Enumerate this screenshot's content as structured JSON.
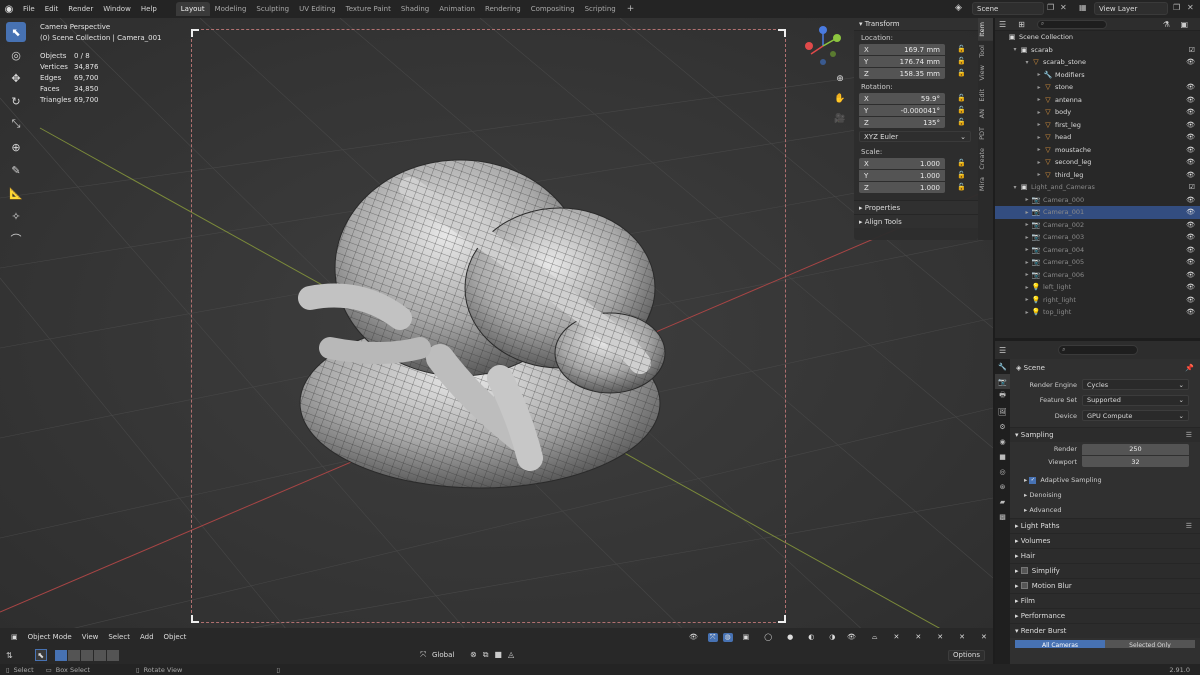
{
  "menu": [
    "File",
    "Edit",
    "Render",
    "Window",
    "Help"
  ],
  "workspaces": [
    "Layout",
    "Modeling",
    "Sculpting",
    "UV Editing",
    "Texture Paint",
    "Shading",
    "Animation",
    "Rendering",
    "Compositing",
    "Scripting"
  ],
  "active_workspace": "Layout",
  "scene_name": "Scene",
  "view_layer": "View Layer",
  "viewport": {
    "title": "Camera Perspective",
    "collection": "(0) Scene Collection | Camera_001",
    "stats": [
      {
        "k": "Objects",
        "v": "0 / 8"
      },
      {
        "k": "Vertices",
        "v": "34,876"
      },
      {
        "k": "Edges",
        "v": "69,700"
      },
      {
        "k": "Faces",
        "v": "34,850"
      },
      {
        "k": "Triangles",
        "v": "69,700"
      }
    ]
  },
  "npanel": {
    "header": "Transform",
    "location_label": "Location:",
    "location": [
      {
        "axis": "X",
        "value": "169.7 mm"
      },
      {
        "axis": "Y",
        "value": "176.74 mm"
      },
      {
        "axis": "Z",
        "value": "158.35 mm"
      }
    ],
    "rotation_label": "Rotation:",
    "rotation": [
      {
        "axis": "X",
        "value": "59.9°"
      },
      {
        "axis": "Y",
        "value": "-0.000041°"
      },
      {
        "axis": "Z",
        "value": "135°"
      }
    ],
    "rotation_mode": "XYZ Euler",
    "scale_label": "Scale:",
    "scale": [
      {
        "axis": "X",
        "value": "1.000"
      },
      {
        "axis": "Y",
        "value": "1.000"
      },
      {
        "axis": "Z",
        "value": "1.000"
      }
    ],
    "properties": "Properties",
    "align_tools": "Align Tools",
    "tabs": [
      "Item",
      "Tool",
      "View",
      "Edit",
      "AN",
      "PDT",
      "Create",
      "Mira"
    ]
  },
  "viewport_header": {
    "mode": "Object Mode",
    "items": [
      "View",
      "Select",
      "Add",
      "Object"
    ]
  },
  "viewport_footer": {
    "orientation": "Global",
    "options": "Options"
  },
  "statusbar": {
    "select": "Select",
    "box_select": "Box Select",
    "rotate_view": "Rotate View",
    "version": "2.91.0"
  },
  "outliner": {
    "rows": [
      {
        "name": "Scene Collection",
        "indent": 0,
        "type": "collection",
        "arrow": "",
        "sel": false,
        "dim": false
      },
      {
        "name": "scarab",
        "indent": 1,
        "type": "collection",
        "arrow": "▾",
        "sel": false,
        "dim": false
      },
      {
        "name": "scarab_stone",
        "indent": 2,
        "type": "mesh",
        "arrow": "▾",
        "sel": false,
        "dim": false
      },
      {
        "name": "Modifiers",
        "indent": 3,
        "type": "wrench",
        "arrow": "▸",
        "sel": false,
        "dim": false
      },
      {
        "name": "stone",
        "indent": 3,
        "type": "mesh",
        "arrow": "▸",
        "sel": false,
        "dim": false
      },
      {
        "name": "antenna",
        "indent": 3,
        "type": "mesh",
        "arrow": "▸",
        "sel": false,
        "dim": false
      },
      {
        "name": "body",
        "indent": 3,
        "type": "mesh",
        "arrow": "▸",
        "sel": false,
        "dim": false
      },
      {
        "name": "first_leg",
        "indent": 3,
        "type": "mesh",
        "arrow": "▸",
        "sel": false,
        "dim": false
      },
      {
        "name": "head",
        "indent": 3,
        "type": "mesh",
        "arrow": "▸",
        "sel": false,
        "dim": false
      },
      {
        "name": "moustache",
        "indent": 3,
        "type": "mesh",
        "arrow": "▸",
        "sel": false,
        "dim": false
      },
      {
        "name": "second_leg",
        "indent": 3,
        "type": "mesh",
        "arrow": "▸",
        "sel": false,
        "dim": false
      },
      {
        "name": "third_leg",
        "indent": 3,
        "type": "mesh",
        "arrow": "▸",
        "sel": false,
        "dim": false
      },
      {
        "name": "Light_and_Cameras",
        "indent": 1,
        "type": "collection",
        "arrow": "▾",
        "sel": false,
        "dim": true
      },
      {
        "name": "Camera_000",
        "indent": 2,
        "type": "camera",
        "arrow": "▸",
        "sel": false,
        "dim": true
      },
      {
        "name": "Camera_001",
        "indent": 2,
        "type": "camera",
        "arrow": "▸",
        "sel": true,
        "dim": true
      },
      {
        "name": "Camera_002",
        "indent": 2,
        "type": "camera",
        "arrow": "▸",
        "sel": false,
        "dim": true
      },
      {
        "name": "Camera_003",
        "indent": 2,
        "type": "camera",
        "arrow": "▸",
        "sel": false,
        "dim": true
      },
      {
        "name": "Camera_004",
        "indent": 2,
        "type": "camera",
        "arrow": "▸",
        "sel": false,
        "dim": true
      },
      {
        "name": "Camera_005",
        "indent": 2,
        "type": "camera",
        "arrow": "▸",
        "sel": false,
        "dim": true
      },
      {
        "name": "Camera_006",
        "indent": 2,
        "type": "camera",
        "arrow": "▸",
        "sel": false,
        "dim": true
      },
      {
        "name": "left_light",
        "indent": 2,
        "type": "light",
        "arrow": "▸",
        "sel": false,
        "dim": true
      },
      {
        "name": "right_light",
        "indent": 2,
        "type": "light",
        "arrow": "▸",
        "sel": false,
        "dim": true
      },
      {
        "name": "top_light",
        "indent": 2,
        "type": "light",
        "arrow": "▸",
        "sel": false,
        "dim": true
      }
    ]
  },
  "properties": {
    "context": "Scene",
    "render_engine_label": "Render Engine",
    "render_engine": "Cycles",
    "feature_set_label": "Feature Set",
    "feature_set": "Supported",
    "device_label": "Device",
    "device": "GPU Compute",
    "sampling": "Sampling",
    "render_label": "Render",
    "render_samples": "250",
    "viewport_label": "Viewport",
    "viewport_samples": "32",
    "adaptive_sampling": "Adaptive Sampling",
    "denoising": "Denoising",
    "advanced": "Advanced",
    "sections": [
      "Light Paths",
      "Volumes",
      "Hair",
      "Simplify",
      "Motion Blur",
      "Film",
      "Performance",
      "Render Burst"
    ],
    "burst_buttons": [
      "All Cameras",
      "Selected Only"
    ]
  },
  "colors": {
    "accent": "#4772b3",
    "x_axis": "#e04a4a",
    "y_axis": "#8dc63f",
    "z_axis": "#4a7be0"
  }
}
